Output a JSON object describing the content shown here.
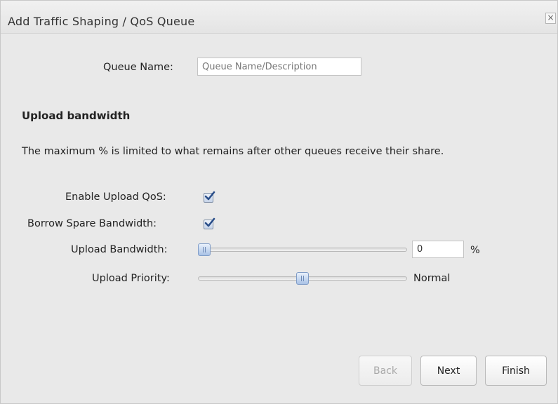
{
  "dialog": {
    "title": "Add Traffic Shaping / QoS Queue",
    "close_symbol": "×"
  },
  "queue": {
    "label": "Queue Name:",
    "value": "",
    "placeholder": "Queue Name/Description"
  },
  "upload": {
    "section_title": "Upload bandwidth",
    "description": "The maximum % is limited to what remains after other queues receive their share.",
    "enable_qos": {
      "label": "Enable Upload QoS:",
      "checked": true
    },
    "borrow_spare": {
      "label": "Borrow Spare Bandwidth:",
      "checked": true
    },
    "bandwidth": {
      "label": "Upload Bandwidth:",
      "value": "0",
      "unit": "%",
      "slider_percent": 0
    },
    "priority": {
      "label": "Upload Priority:",
      "value_text": "Normal",
      "slider_level": 0.5
    }
  },
  "buttons": {
    "back": {
      "label": "Back",
      "enabled": false
    },
    "next": {
      "label": "Next"
    },
    "finish": {
      "label": "Finish"
    }
  },
  "icons": {
    "checkbox_check": "check-icon",
    "close": "close-icon",
    "slider_grip": "grip-icon"
  },
  "colors": {
    "dialog_bg": "#e9e9e9",
    "titlebar_bg": "#ececec",
    "checkbox_accent": "#2b4f8a",
    "slider_handle": "#a9c2e6"
  }
}
